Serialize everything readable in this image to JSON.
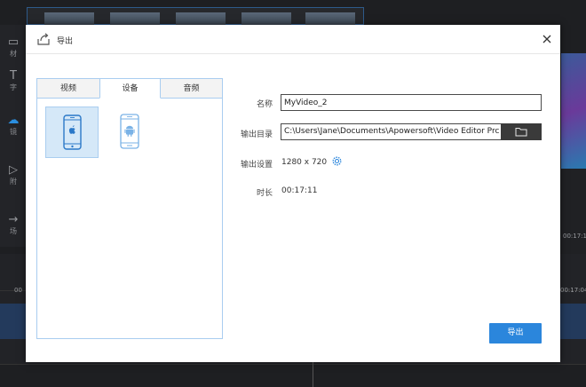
{
  "background": {
    "tools": [
      {
        "label": "材",
        "icon": "folder-icon"
      },
      {
        "label": "字",
        "icon": "text-icon"
      },
      {
        "label": "镜",
        "icon": "cloud-icon"
      },
      {
        "label": "附",
        "icon": "play-icon"
      },
      {
        "label": "场",
        "icon": "arrow-icon"
      }
    ],
    "right_time": "00:17:1",
    "ruler_right_time": "00:17:04:0",
    "ruler_left_time": "00"
  },
  "dialog": {
    "title": "导出",
    "tabs": [
      "视频",
      "设备",
      "音频"
    ],
    "active_tab": "设备",
    "devices": [
      {
        "name": "iphone",
        "selected": true
      },
      {
        "name": "android",
        "selected": false
      }
    ],
    "form": {
      "name_label": "名称",
      "name_value": "MyVideo_2",
      "output_dir_label": "输出目录",
      "output_dir_value": "C:\\Users\\Jane\\Documents\\Apowersoft\\Video Editor Prc",
      "output_settings_label": "输出设置",
      "output_settings_value": "1280 x 720",
      "duration_label": "时长",
      "duration_value": "00:17:11"
    },
    "export_button": "导出"
  },
  "colors": {
    "accent": "#2b86dc",
    "tab_border": "#a9cdf0",
    "selected_tile": "#d5e8f8",
    "browse_bg": "#3a3a3a"
  }
}
